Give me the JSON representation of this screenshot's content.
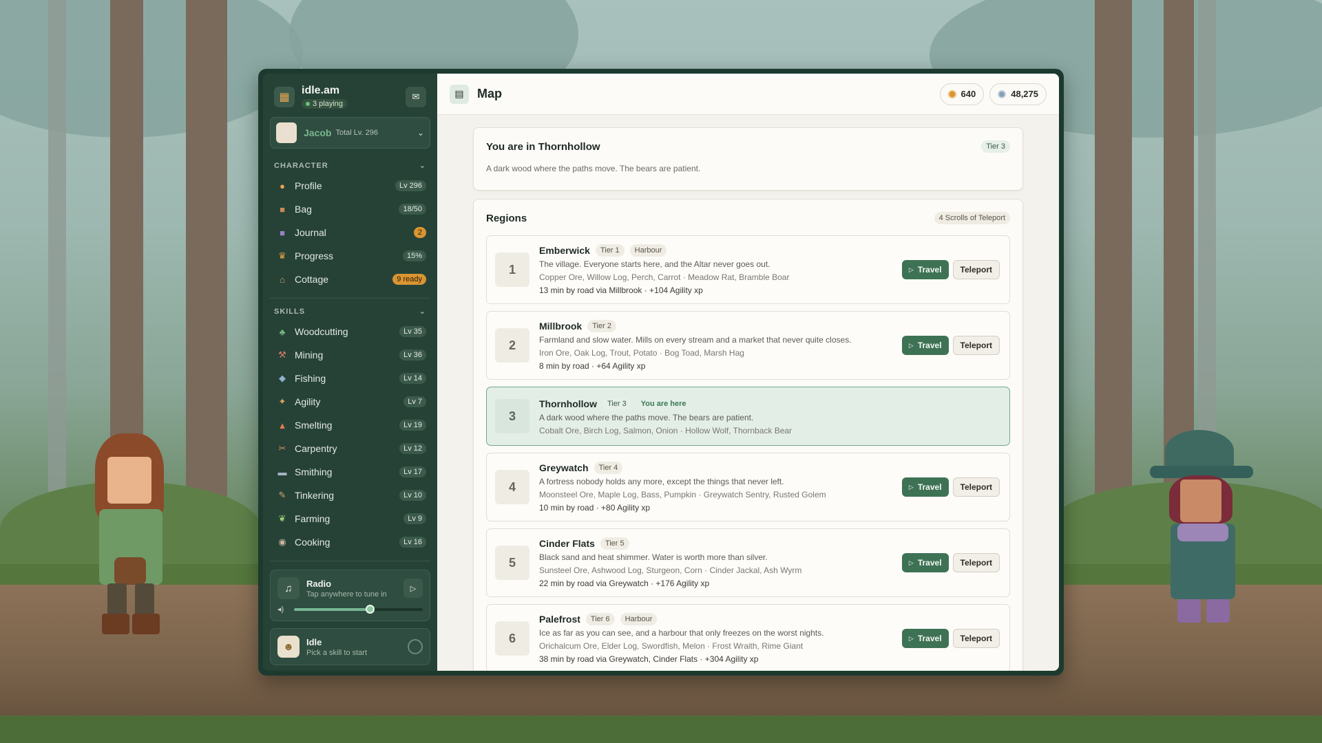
{
  "app": {
    "name": "idle.am",
    "players": "3 playing"
  },
  "player": {
    "name": "Jacob",
    "total_level": "Total Lv. 296"
  },
  "character": {
    "heading": "CHARACTER",
    "items": [
      {
        "label": "Profile",
        "badge": "Lv 296",
        "icon": "profile-icon"
      },
      {
        "label": "Bag",
        "badge": "18/50",
        "icon": "bag-icon"
      },
      {
        "label": "Journal",
        "badge": "2",
        "icon": "journal-icon"
      },
      {
        "label": "Progress",
        "badge": "15%",
        "icon": "trophy-icon"
      },
      {
        "label": "Cottage",
        "badge": "9 ready",
        "icon": "cottage-icon"
      }
    ]
  },
  "skills": {
    "heading": "SKILLS",
    "items": [
      {
        "label": "Woodcutting",
        "badge": "Lv 35",
        "icon": "tree-icon"
      },
      {
        "label": "Mining",
        "badge": "Lv 36",
        "icon": "pickaxe-icon"
      },
      {
        "label": "Fishing",
        "badge": "Lv 14",
        "icon": "fish-icon"
      },
      {
        "label": "Agility",
        "badge": "Lv 7",
        "icon": "runner-icon"
      },
      {
        "label": "Smelting",
        "badge": "Lv 19",
        "icon": "furnace-icon"
      },
      {
        "label": "Carpentry",
        "badge": "Lv 12",
        "icon": "saw-icon"
      },
      {
        "label": "Smithing",
        "badge": "Lv 17",
        "icon": "anvil-icon"
      },
      {
        "label": "Tinkering",
        "badge": "Lv 10",
        "icon": "wrench-icon"
      },
      {
        "label": "Farming",
        "badge": "Lv 9",
        "icon": "sprout-icon"
      },
      {
        "label": "Cooking",
        "badge": "Lv 16",
        "icon": "pot-icon"
      }
    ]
  },
  "radio": {
    "title": "Radio",
    "subtitle": "Tap anywhere to tune in",
    "volume": 0.59
  },
  "activity": {
    "title": "Idle",
    "subtitle": "Pick a skill to start"
  },
  "header": {
    "title": "Map",
    "gold": "640",
    "silver": "48,275"
  },
  "location": {
    "title": "You are in Thornhollow",
    "tier": "Tier 3",
    "description": "A dark wood where the paths move. The bears are patient."
  },
  "regions_panel": {
    "title": "Regions",
    "scrolls": "4 Scrolls of Teleport"
  },
  "buttons": {
    "travel": "Travel",
    "teleport": "Teleport"
  },
  "regions": [
    {
      "num": "1",
      "name": "Emberwick",
      "tier": "Tier 1",
      "tag": "Harbour",
      "desc": "The village. Everyone starts here, and the Altar never goes out.",
      "resources": "Copper Ore, Willow Log, Perch, Carrot · Meadow Rat, Bramble Boar",
      "travel": "13 min by road via Millbrook · +104 Agility xp"
    },
    {
      "num": "2",
      "name": "Millbrook",
      "tier": "Tier 2",
      "desc": "Farmland and slow water. Mills on every stream and a market that never quite closes.",
      "resources": "Iron Ore, Oak Log, Trout, Potato · Bog Toad, Marsh Hag",
      "travel": "8 min by road · +64 Agility xp"
    },
    {
      "num": "3",
      "name": "Thornhollow",
      "tier": "Tier 3",
      "here": "You are here",
      "desc": "A dark wood where the paths move. The bears are patient.",
      "resources": "Cobalt Ore, Birch Log, Salmon, Onion · Hollow Wolf, Thornback Bear"
    },
    {
      "num": "4",
      "name": "Greywatch",
      "tier": "Tier 4",
      "desc": "A fortress nobody holds any more, except the things that never left.",
      "resources": "Moonsteel Ore, Maple Log, Bass, Pumpkin · Greywatch Sentry, Rusted Golem",
      "travel": "10 min by road · +80 Agility xp"
    },
    {
      "num": "5",
      "name": "Cinder Flats",
      "tier": "Tier 5",
      "desc": "Black sand and heat shimmer. Water is worth more than silver.",
      "resources": "Sunsteel Ore, Ashwood Log, Sturgeon, Corn · Cinder Jackal, Ash Wyrm",
      "travel": "22 min by road via Greywatch · +176 Agility xp"
    },
    {
      "num": "6",
      "name": "Palefrost",
      "tier": "Tier 6",
      "tag": "Harbour",
      "desc": "Ice as far as you can see, and a harbour that only freezes on the worst nights.",
      "resources": "Orichalcum Ore, Elder Log, Swordfish, Melon · Frost Wraith, Rime Giant",
      "travel": "38 min by road via Greywatch, Cinder Flats · +304 Agility xp"
    }
  ],
  "colors": {
    "accent": "#3e7255",
    "sidebar": "#264237",
    "badge_orange": "#d99532",
    "gold": "#d99532",
    "silver": "#8aa0b8"
  }
}
